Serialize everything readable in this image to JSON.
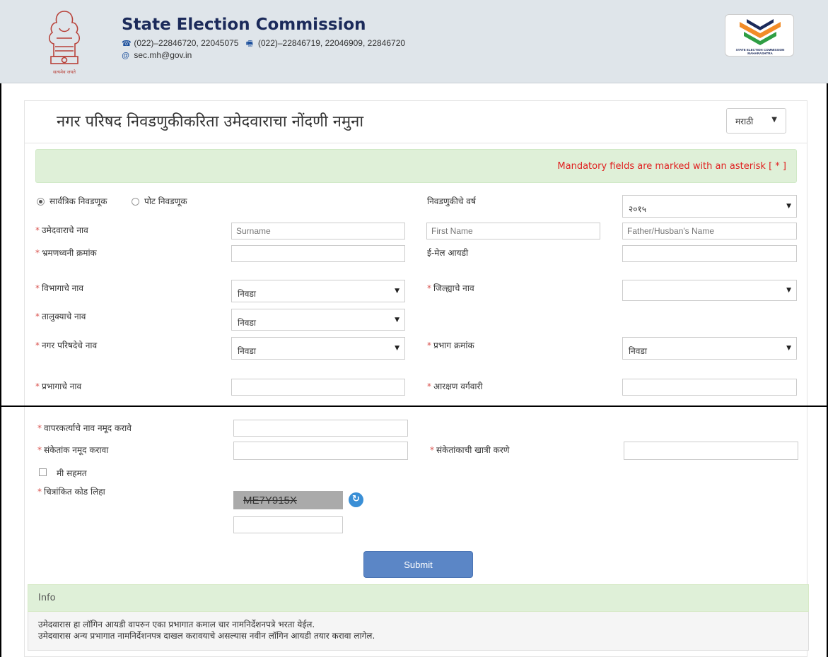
{
  "header": {
    "title": "State Election Commission",
    "phone": "(022)–22846720, 22045075",
    "fax": "(022)–22846719, 22046909, 22846720",
    "email": "sec.mh@gov.in",
    "emblem_caption": "सत्यमेव जयते",
    "logo_caption": "STATE ELECTION COMMISSION MAHARASHTRA"
  },
  "page": {
    "title": "नगर परिषद निवडणुकीकरिता उमेदवाराचा नोंदणी नमुना",
    "language": "मराठी"
  },
  "alert": "Mandatory fields are marked with an asterisk [ * ]",
  "form": {
    "election_type": {
      "general": "सार्वत्रिक निवडणूक",
      "by": "पोट निवडणूक",
      "selected": "general"
    },
    "election_year_label": "निवडणुकीचे वर्ष",
    "election_year_value": "२०१५",
    "candidate_name_label": "उमेदवाराचे नाव",
    "surname_placeholder": "Surname",
    "firstname_placeholder": "First Name",
    "father_placeholder": "Father/Husban's Name",
    "mobile_label": "भ्रमणध्वनी क्रमांक",
    "email_label": "ई-मेल आयडी",
    "division_label": "विभागाचे नाव",
    "division_value": "निवडा",
    "district_label": "जिल्ह्याचे नाव",
    "district_value": "",
    "taluka_label": "तालुक्याचे नाव",
    "taluka_value": "निवडा",
    "council_label": "नगर परिषदेचे नाव",
    "council_value": "निवडा",
    "ward_no_label": "प्रभाग क्रमांक",
    "ward_no_value": "निवडा",
    "ward_name_label": "प्रभागाचे नाव",
    "reservation_label": "आरक्षण वर्गवारी",
    "username_label": "वापरकर्त्याचे नाव नमूद करावे",
    "password_label": "संकेतांक नमूद करावा",
    "confirm_label": "संकेतांकाची खात्री करणे",
    "agree_label": "मी सहमत",
    "captcha_label": "चित्रांकित कोड लिहा",
    "captcha_text": "ME7Y915X",
    "submit": "Submit"
  },
  "info": {
    "heading": "Info",
    "line1": "उमेदवारास हा लॉगिन आयडी वापरुन एका प्रभागात कमाल चार नामनिर्देशनपत्रे भरता येईल.",
    "line2": "उमेदवारास अन्य प्रभागात नामनिर्देशनपत्र दाखल करावयाचे असल्यास नवीन लॉगिन आयडी तयार करावा लागेल."
  },
  "colors": {
    "header_bg": "#dfe5ea",
    "alert_bg": "#dff0d8",
    "required": "#d9534f",
    "submit": "#5b86c6"
  }
}
